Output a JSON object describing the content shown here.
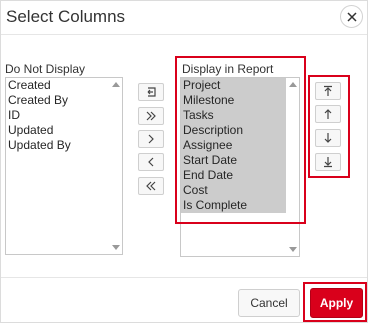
{
  "dialog": {
    "title": "Select Columns",
    "close_icon": "close-icon"
  },
  "do_not_display": {
    "label": "Do Not Display",
    "items": [
      "Created",
      "Created By",
      "ID",
      "Updated",
      "Updated By"
    ]
  },
  "display_in_report": {
    "label": "Display in Report",
    "items": [
      "Project",
      "Milestone",
      "Tasks",
      "Description",
      "Assignee",
      "Start Date",
      "End Date",
      "Cost",
      "Is Complete"
    ]
  },
  "shuttle_icons": [
    "reset-icon",
    "move-all-right-icon",
    "move-right-icon",
    "move-left-icon",
    "move-all-left-icon"
  ],
  "order_icons": [
    "move-top-icon",
    "move-up-icon",
    "move-down-icon",
    "move-bottom-icon"
  ],
  "footer": {
    "cancel_label": "Cancel",
    "apply_label": "Apply"
  },
  "colors": {
    "accent": "#d9001b",
    "selection": "#cccccc"
  }
}
